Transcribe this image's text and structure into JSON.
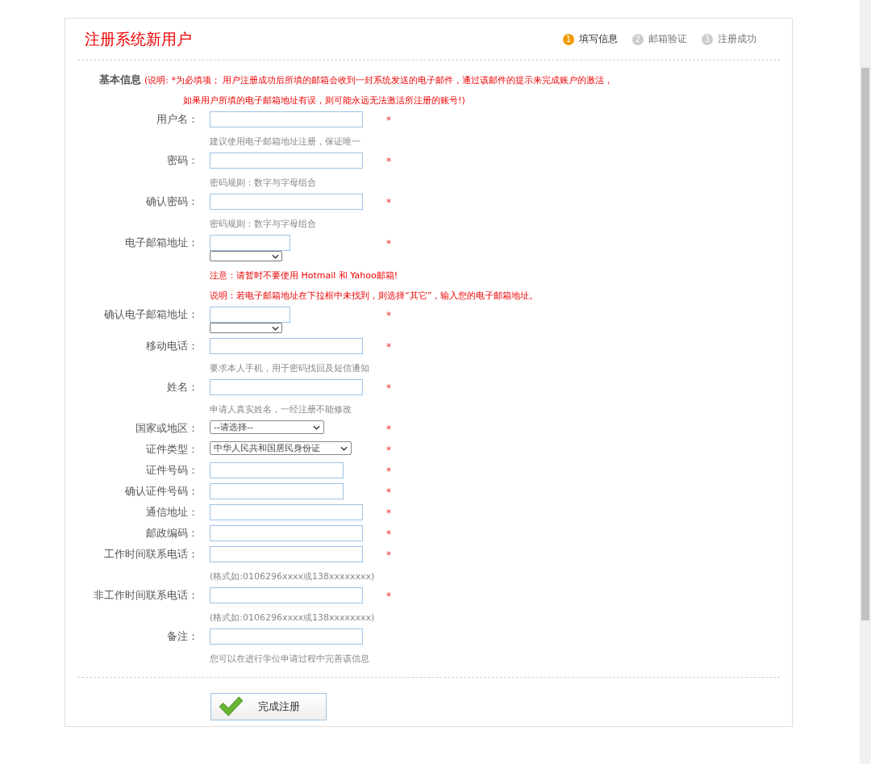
{
  "title": "注册系统新用户",
  "steps": [
    {
      "number": "1",
      "label": "填写信息",
      "selected": true
    },
    {
      "number": "2",
      "label": "邮箱验证",
      "selected": false
    },
    {
      "number": "3",
      "label": "注册成功",
      "selected": false
    }
  ],
  "section": {
    "heading": "基本信息",
    "note_line_1": "(说明: *为必填项； 用户注册成功后所填的邮箱会收到一封系统发送的电子邮件，通过该邮件的提示来完成账户的激活，",
    "note_line_2": "如果用户所填的电子邮箱地址有误，则可能永远无法激活所注册的账号!)"
  },
  "fields": [
    {
      "label": "用户名：",
      "kind": "input",
      "required": "*",
      "hints": [
        {
          "text": "建议使用电子邮箱地址注册，保证唯一",
          "kind": "hint"
        }
      ]
    },
    {
      "label": "密码：",
      "kind": "input",
      "required": "*",
      "hints": [
        {
          "text": "密码规则：数字与字母组合",
          "kind": "hint"
        }
      ]
    },
    {
      "label": "确认密码：",
      "kind": "input",
      "required": "*",
      "hints": [
        {
          "text": "密码规则：数字与字母组合",
          "kind": "hint"
        }
      ]
    },
    {
      "label": "电子邮箱地址：",
      "kind": "email",
      "required": "*",
      "hints": [
        {
          "text": "注意：请暂时不要使用 Hotmail 和 Yahoo邮箱!",
          "kind": "warning"
        },
        {
          "text": "说明：若电子邮箱地址在下拉框中未找到，则选择“其它”，输入您的电子邮箱地址。",
          "kind": "warning"
        }
      ]
    },
    {
      "label": "确认电子邮箱地址：",
      "kind": "email",
      "required": "*"
    },
    {
      "label": "移动电话：",
      "kind": "input",
      "required": "*",
      "hints": [
        {
          "text": "要求本人手机，用于密码找回及短信通知",
          "kind": "hint"
        }
      ]
    },
    {
      "label": "姓名：",
      "kind": "input",
      "required": "*",
      "hints": [
        {
          "text": "申请人真实姓名，一经注册不能修改",
          "kind": "hint"
        }
      ]
    },
    {
      "label": "国家或地区：",
      "kind": "select",
      "value": "--请选择--",
      "required": "*"
    },
    {
      "label": "证件类型：",
      "kind": "select-wide",
      "value": "中华人民共和国居民身份证",
      "required": "*"
    },
    {
      "label": "证件号码：",
      "kind": "short",
      "required": "*"
    },
    {
      "label": "确认证件号码：",
      "kind": "short",
      "required": "*"
    },
    {
      "label": "通信地址：",
      "kind": "input",
      "required": "*"
    },
    {
      "label": "邮政编码：",
      "kind": "input",
      "required": "*"
    },
    {
      "label": "工作时间联系电话：",
      "kind": "input",
      "required": "*",
      "hints": [
        {
          "text": "(格式如:0106296xxxx或138xxxxxxxx)",
          "kind": "hint"
        }
      ]
    },
    {
      "label": "非工作时间联系电话：",
      "kind": "input",
      "required": "*",
      "hints": [
        {
          "text": "(格式如:0106296xxxx或138xxxxxxxx)",
          "kind": "hint"
        }
      ]
    },
    {
      "label": "备注：",
      "kind": "input",
      "hints": [
        {
          "text": "您可以在进行学位申请过程中完善该信息",
          "kind": "hint"
        }
      ]
    }
  ],
  "submit": "完成注册"
}
